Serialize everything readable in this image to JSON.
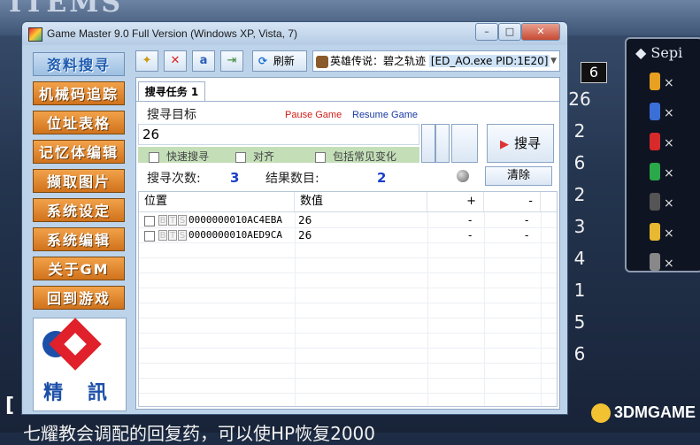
{
  "window": {
    "title": "Game Master 9.0 Full Version (Windows XP, Vista, 7)",
    "min_label": "–",
    "max_label": "□",
    "close_label": "✕"
  },
  "menu": [
    {
      "label": "资料搜寻",
      "active": true
    },
    {
      "label": "机械码追踪"
    },
    {
      "label": "位址表格"
    },
    {
      "label": "记忆体编辑"
    },
    {
      "label": "撷取图片"
    },
    {
      "label": "系统设定"
    },
    {
      "label": "系统编辑"
    },
    {
      "label": "关于GM"
    },
    {
      "label": "回到游戏"
    }
  ],
  "logo": {
    "text": "精 訊"
  },
  "toolbar": {
    "refresh_label": "刷新",
    "process": "英雄传说：碧之轨迹",
    "process_id": "[ED_AO.exe PID:1E20]"
  },
  "search": {
    "tab_label": "搜寻任务 1",
    "target_label": "搜寻目标",
    "pause_label": "Pause Game",
    "resume_label": "Resume Game",
    "value": "26",
    "options": [
      "快速搜寻",
      "对齐",
      "包括常见变化"
    ],
    "search_button": "搜寻",
    "count_label": "搜寻次数:",
    "count_value": "3",
    "result_label": "结果数目:",
    "result_value": "2",
    "clear_button": "清除"
  },
  "table": {
    "headers": [
      "位置",
      "数值",
      "+",
      "-"
    ],
    "rows": [
      {
        "tags": [
          "B",
          "T",
          "S"
        ],
        "address": "0000000010AC4EBA",
        "value": "26",
        "plus": "-",
        "minus": "-"
      },
      {
        "tags": [
          "B",
          "T",
          "S"
        ],
        "address": "0000000010AED9CA",
        "value": "26",
        "plus": "-",
        "minus": "-"
      }
    ]
  },
  "background": {
    "logo_text": "ITEMS",
    "panel_title": "Sepi",
    "gem_colors": [
      "#e8a020",
      "#3a6fd8",
      "#d82a2a",
      "#2aa84a",
      "#555555",
      "#e8b830",
      "#888888"
    ],
    "gem_mark": "×",
    "numbers": [
      "26",
      "2",
      "6",
      "2",
      "3",
      "4",
      "1",
      "5",
      "6"
    ],
    "badge": "6",
    "bottom_bracket": "[",
    "bottom_text": "七耀教会调配的回复药，可以使HP恢复2000",
    "watermark": "3DMGAME"
  }
}
